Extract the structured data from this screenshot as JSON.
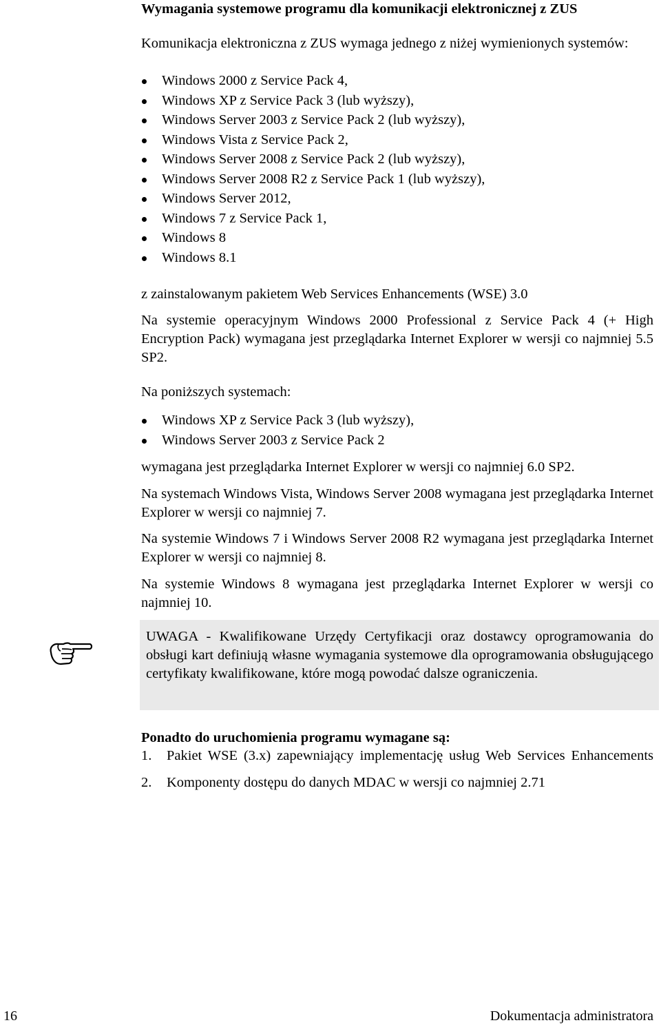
{
  "document": {
    "title": "Wymagania systemowe programu dla komunikacji elektronicznej z ZUS",
    "intro": "Komunikacja elektroniczna z ZUS wymaga jednego z niżej wymienionych systemów:",
    "systems": [
      "Windows 2000 z Service Pack 4,",
      "Windows XP z Service Pack 3 (lub wyższy),",
      "Windows Server 2003 z Service Pack 2 (lub wyższy),",
      "Windows Vista z Service Pack 2,",
      "Windows Server 2008 z Service Pack 2 (lub wyższy),",
      "Windows Server 2008 R2 z Service Pack 1 (lub wyższy),",
      "Windows Server 2012,",
      "Windows 7 z Service Pack 1,",
      "Windows 8",
      "Windows 8.1"
    ],
    "wse_requirement": "z zainstalowanym pakietem Web Services Enhancements (WSE) 3.0",
    "win2000_note": "Na systemie operacyjnym Windows 2000 Professional z Service Pack 4 (+ High Encryption Pack) wymagana jest przeglądarka Internet Explorer w wersji co najmniej 5.5 SP2.",
    "below_systems_intro": "Na poniższych systemach:",
    "below_systems": [
      "Windows XP z Service Pack 3 (lub wyższy),",
      "Windows Server 2003 z Service Pack 2"
    ],
    "ie6_requirement": "wymagana jest przeglądarka Internet Explorer w wersji co najmniej 6.0 SP2.",
    "vista_note": "Na systemach Windows Vista, Windows Server 2008 wymagana jest przeglądarka Internet Explorer w wersji co najmniej 7.",
    "win7_note": "Na systemie Windows 7 i Windows Server 2008 R2 wymagana jest przeglądarka Internet Explorer w wersji co najmniej 8.",
    "win8_note": "Na systemie Windows 8 wymagana jest przeglądarka Internet Explorer w wersji co najmniej 10.",
    "note": {
      "icon": "pointing-hand-icon",
      "text": "UWAGA - Kwalifikowane Urzędy Certyfikacji oraz dostawcy oprogramowania do obsługi kart definiują własne wymagania systemowe dla oprogramowania obsługującego certyfikaty kwalifikowane, które mogą powodać dalsze ograniczenia.",
      "background": "#e9e9e9"
    },
    "additional_heading": "Ponadto do uruchomienia programu wymagane są:",
    "additional_items": [
      {
        "num": "1.",
        "text": "Pakiet WSE (3.x) zapewniający implementację usług Web Services Enhancements"
      },
      {
        "num": "2.",
        "text": "Komponenty dostępu do danych MDAC w wersji co najmniej 2.71"
      }
    ]
  },
  "footer": {
    "page_number": "16",
    "section_title": "Dokumentacja administratora"
  }
}
